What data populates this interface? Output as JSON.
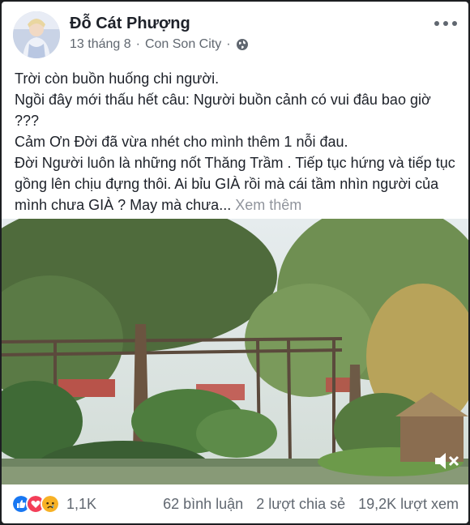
{
  "post": {
    "author": "Đỗ Cát Phượng",
    "date": "13 tháng 8",
    "separator": "·",
    "location": "Con Son City",
    "privacy_icon": "globe-icon",
    "lines": [
      "Trời còn buồn huống chi người.",
      "Ngồi đây mới thấu hết câu: Người buồn cảnh có vui đâu bao giờ ???",
      "Cảm Ơn Đời đã vừa nhét cho mình thêm 1 nỗi đau.",
      "Đời Người luôn là những nốt Thăng Trầm . Tiếp tục hứng và tiếp tục gồng lên chịu đựng thôi. Ai bỉu GIÀ rồi mà cái tầm nhìn người của mình chưa GIÀ ? May mà chưa..."
    ],
    "see_more": "Xem thêm"
  },
  "video": {
    "mute_icon": "speaker-muted-icon"
  },
  "footer": {
    "reaction_icons": [
      "like-icon",
      "love-icon",
      "sad-icon"
    ],
    "reaction_count": "1,1K",
    "comments": "62 bình luận",
    "shares": "2 lượt chia sẻ",
    "views": "19,2K lượt xem"
  },
  "colors": {
    "like": "#1877f2",
    "love": "#f33e58",
    "sad": "#f7b125",
    "text": "#1d2129",
    "muted": "#606770"
  }
}
